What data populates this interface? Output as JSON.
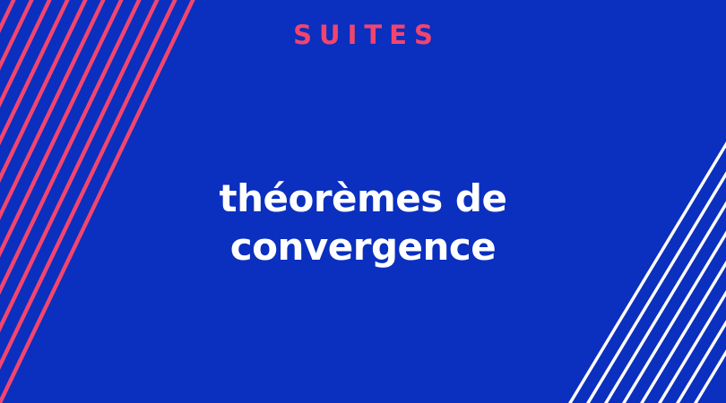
{
  "banner": {
    "category": "SUITES",
    "title_line1": "théorèmes de",
    "title_line2": "convergence"
  },
  "colors": {
    "background": "#0b2fbf",
    "accent": "#f2456e",
    "text": "#ffffff",
    "left_stripes": "#f2456e",
    "right_stripes": "#ffffff"
  },
  "decoration": {
    "left_stripes_count": 11,
    "right_stripes_count": 8
  }
}
